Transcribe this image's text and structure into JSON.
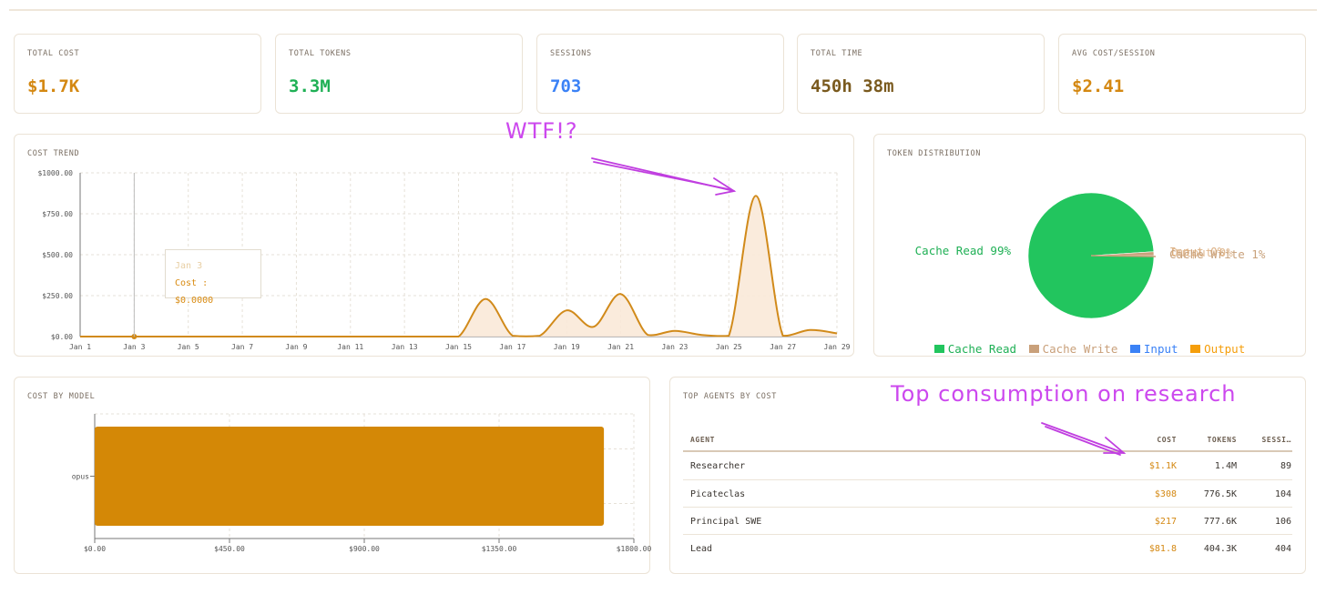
{
  "stats": [
    {
      "label": "TOTAL COST",
      "value": "$1.7K",
      "color": "#d48812"
    },
    {
      "label": "TOTAL TOKENS",
      "value": "3.3M",
      "color": "#1fb055"
    },
    {
      "label": "SESSIONS",
      "value": "703",
      "color": "#3b82f6"
    },
    {
      "label": "TOTAL TIME",
      "value": "450h 38m",
      "color": "#7a5a1e"
    },
    {
      "label": "AVG COST/SESSION",
      "value": "$2.41",
      "color": "#d48812"
    }
  ],
  "cost_trend": {
    "title": "COST TREND",
    "tooltip": {
      "date": "Jan 3",
      "text": "Cost : $0.0000"
    }
  },
  "token_distribution": {
    "title": "TOKEN DISTRIBUTION",
    "slice_labels": [
      {
        "text": "Cache Read 99%",
        "color": "#1fb055"
      },
      {
        "text": "Input 0%",
        "color": "#d9a876"
      },
      {
        "text": "Output 0%",
        "color": "#d9a876"
      },
      {
        "text": "Cache Write 1%",
        "color": "#c9a27c"
      }
    ],
    "legend": [
      {
        "label": "Cache Read",
        "color": "#22c55e",
        "text_color": "#1fb055"
      },
      {
        "label": "Cache Write",
        "color": "#c9a07a",
        "text_color": "#c9a07a"
      },
      {
        "label": "Input",
        "color": "#3b82f6",
        "text_color": "#3b82f6"
      },
      {
        "label": "Output",
        "color": "#f59e0b",
        "text_color": "#f59e0b"
      }
    ]
  },
  "cost_by_model": {
    "title": "COST BY MODEL"
  },
  "top_agents": {
    "title": "TOP AGENTS BY COST",
    "columns": [
      "AGENT",
      "COST",
      "TOKENS",
      "SESSI…"
    ],
    "rows": [
      {
        "agent": "Researcher",
        "cost": "$1.1K",
        "tokens": "1.4M",
        "sessions": "89"
      },
      {
        "agent": "Picateclas",
        "cost": "$308",
        "tokens": "776.5K",
        "sessions": "104"
      },
      {
        "agent": "Principal SWE",
        "cost": "$217",
        "tokens": "777.6K",
        "sessions": "106"
      },
      {
        "agent": "Lead",
        "cost": "$81.8",
        "tokens": "404.3K",
        "sessions": "404"
      }
    ]
  },
  "annotations": {
    "wtf": "WTF!?",
    "research": "Top consumption on research"
  },
  "chart_data": [
    {
      "type": "area",
      "title": "COST TREND",
      "x": [
        "Jan 1",
        "Jan 2",
        "Jan 3",
        "Jan 4",
        "Jan 5",
        "Jan 6",
        "Jan 7",
        "Jan 8",
        "Jan 9",
        "Jan 10",
        "Jan 11",
        "Jan 12",
        "Jan 13",
        "Jan 14",
        "Jan 15",
        "Jan 16",
        "Jan 17",
        "Jan 18",
        "Jan 19",
        "Jan 20",
        "Jan 21",
        "Jan 22",
        "Jan 23",
        "Jan 24",
        "Jan 25",
        "Jan 26",
        "Jan 27",
        "Jan 28",
        "Jan 29"
      ],
      "x_tick_labels": [
        "Jan 1",
        "Jan 3",
        "Jan 5",
        "Jan 7",
        "Jan 9",
        "Jan 11",
        "Jan 13",
        "Jan 15",
        "Jan 17",
        "Jan 19",
        "Jan 21",
        "Jan 23",
        "Jan 25",
        "Jan 27",
        "Jan 29"
      ],
      "values": [
        0,
        0,
        0,
        0,
        0,
        0,
        0,
        0,
        0,
        0,
        0,
        0,
        0,
        0,
        0,
        230,
        5,
        5,
        160,
        60,
        260,
        10,
        35,
        10,
        5,
        860,
        5,
        40,
        20
      ],
      "y_tick_labels": [
        "$0.00",
        "$250.00",
        "$500.00",
        "$750.00",
        "$1000.00"
      ],
      "ylim": [
        0,
        1000
      ],
      "color": "#d18a1a",
      "grid": true
    },
    {
      "type": "pie",
      "title": "TOKEN DISTRIBUTION",
      "labels": [
        "Cache Read",
        "Cache Write",
        "Input",
        "Output"
      ],
      "values": [
        99,
        1,
        0,
        0
      ],
      "colors": [
        "#22c55e",
        "#c9a07a",
        "#3b82f6",
        "#f59e0b"
      ],
      "legend": "bottom"
    },
    {
      "type": "bar",
      "orientation": "horizontal",
      "title": "COST BY MODEL",
      "categories": [
        "opus"
      ],
      "values": [
        1700
      ],
      "x_tick_labels": [
        "$0.00",
        "$450.00",
        "$900.00",
        "$1350.00",
        "$1800.00"
      ],
      "xlim": [
        0,
        1800
      ],
      "color": "#d48806",
      "grid": true
    }
  ]
}
